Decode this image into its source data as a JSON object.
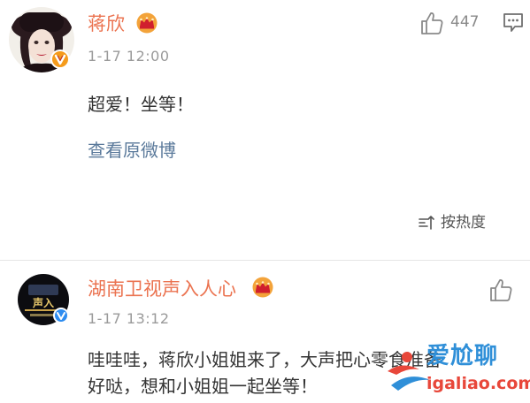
{
  "comments": [
    {
      "username": "蒋欣",
      "time": "1-17 12:00",
      "text": "超爱！坐等！",
      "likes": "447",
      "view_original": "查看原微博",
      "badge_icon": "crown-icon",
      "verify_icon": "orange-v-badge-icon"
    },
    {
      "username": "湖南卫视声入人心",
      "time": "1-17 13:12",
      "text_line1": "哇哇哇，蒋欣小姐姐来了，大声把心零食准备",
      "text_line2": "好哒，想和小姐姐一起坐等！",
      "badge_icon": "crown-icon",
      "verify_icon": "blue-v-badge-icon"
    }
  ],
  "sort": {
    "label": "按热度"
  },
  "watermark": {
    "title": "爱尬聊",
    "url": "igaliao.com"
  },
  "colors": {
    "username": "#eb7350",
    "link": "#5b7a9b",
    "crown": "#f3a33a",
    "blue_v": "#2d8cf0"
  }
}
